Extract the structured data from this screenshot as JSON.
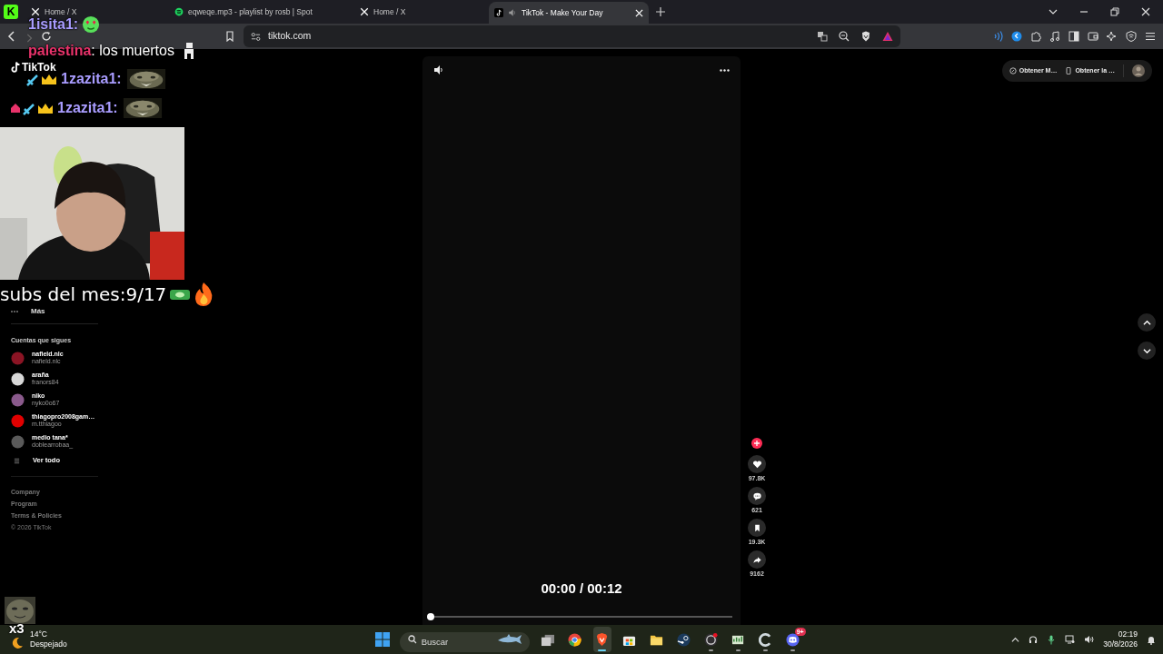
{
  "browser": {
    "pinned_tab": {
      "label": "K"
    },
    "tabs": [
      {
        "title": "Home / X",
        "kind": "x",
        "selected": false,
        "audio": false
      },
      {
        "title": "eqweqe.mp3 - playlist by rosb | Spot",
        "kind": "spotify",
        "selected": false,
        "audio": false
      },
      {
        "title": "Home / X",
        "kind": "x",
        "selected": false,
        "audio": false
      },
      {
        "title": "TikTok - Make Your Day",
        "kind": "tiktok",
        "selected": true,
        "audio": true
      }
    ],
    "url": "tiktok.com"
  },
  "tiktok": {
    "logo": "TikTok",
    "more": "Más",
    "following": {
      "heading": "Cuentas que sigues",
      "accounts": [
        {
          "name": "nafield.nlc",
          "handle": "nafield.nlc",
          "color": "#8b1424"
        },
        {
          "name": "araña",
          "handle": "franors84",
          "color": "#d8d8d8"
        },
        {
          "name": "niko",
          "handle": "nyko0o67",
          "color": "#8a5a8c"
        },
        {
          "name": "thiagopro2008gam…",
          "handle": "m.tthiagoo",
          "color": "#e00000"
        },
        {
          "name": "medio tana*",
          "handle": "doblearrobaa_",
          "color": "#5a5a5a"
        }
      ],
      "see_all": "Ver todo"
    },
    "footer": [
      "Company",
      "Program",
      "Terms & Policies",
      "© 2026 TikTok"
    ],
    "video": {
      "time": "00:00 / 00:12",
      "progress": {
        "level": 0
      }
    },
    "actions": [
      {
        "kind": "like",
        "count": "97.8K"
      },
      {
        "kind": "comment",
        "count": "621"
      },
      {
        "kind": "save",
        "count": "19.3K"
      },
      {
        "kind": "share",
        "count": "9162"
      }
    ],
    "header_buttons": [
      {
        "kind": "app",
        "label": "Obtener M…"
      },
      {
        "kind": "mobile",
        "label": "Obtener la …"
      }
    ]
  },
  "stream_overlay": {
    "chat": [
      {
        "user": "1isita1:",
        "color": "#a99cff",
        "kind": "emoji"
      },
      {
        "user": "palestina",
        "color": "#e8326a",
        "message": ": los muertos",
        "kind": "figure"
      },
      {
        "user": "1zazita1:",
        "color": "#a99cff",
        "kind": "badged"
      },
      {
        "user": "1zazita1:",
        "color": "#a99cff",
        "kind": "homebadged"
      }
    ],
    "subs_goal": "subs del mes:9/17",
    "combo": "x3"
  },
  "taskbar": {
    "weather": {
      "temp": "14°C",
      "condition": "Despejado"
    },
    "search": {
      "placeholder": "Buscar"
    },
    "apps": [
      {
        "kind": "taskview",
        "selected": false,
        "running": false
      },
      {
        "kind": "chrome",
        "selected": false,
        "running": false
      },
      {
        "kind": "brave",
        "selected": true,
        "running": true
      },
      {
        "kind": "store",
        "selected": false,
        "running": false
      },
      {
        "kind": "files",
        "selected": false,
        "running": false
      },
      {
        "kind": "steam",
        "selected": false,
        "running": false
      },
      {
        "kind": "obs",
        "selected": false,
        "running": true
      },
      {
        "kind": "green",
        "selected": false,
        "running": true
      },
      {
        "kind": "c",
        "selected": false,
        "running": true
      },
      {
        "kind": "discord",
        "selected": false,
        "running": true,
        "badge": "9+"
      }
    ],
    "clock": {
      "time": "02:19",
      "date": "30/8/2026"
    }
  }
}
